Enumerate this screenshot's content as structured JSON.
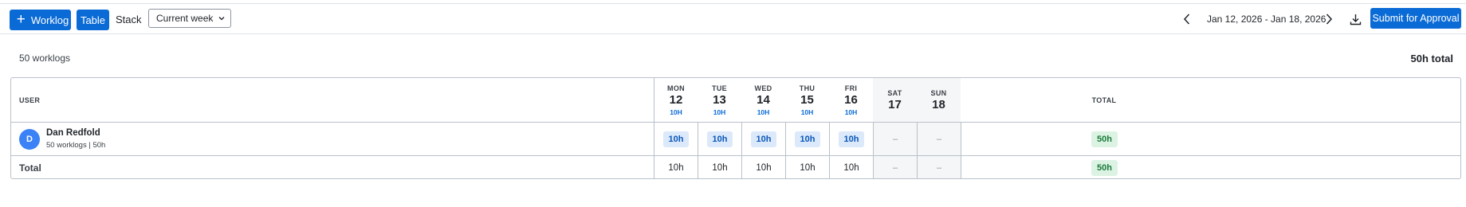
{
  "toolbar": {
    "worklog_label": "Worklog",
    "table_label": "Table",
    "stack_label": "Stack",
    "week_select_value": "Current week",
    "date_range": "Jan 12, 2026 - Jan 18, 2026",
    "submit_label": "Submit for Approval",
    "accent_color": "#0b6bd6"
  },
  "summary": {
    "count": "50 worklogs",
    "total": "50h total"
  },
  "table": {
    "user_header": "USER",
    "total_header": "TOTAL",
    "days": [
      {
        "dow": "MON",
        "num": "12",
        "hours": "10H"
      },
      {
        "dow": "TUE",
        "num": "13",
        "hours": "10H"
      },
      {
        "dow": "WED",
        "num": "14",
        "hours": "10H"
      },
      {
        "dow": "THU",
        "num": "15",
        "hours": "10H"
      },
      {
        "dow": "FRI",
        "num": "16",
        "hours": "10H"
      },
      {
        "dow": "SAT",
        "num": "17",
        "hours": ""
      },
      {
        "dow": "SUN",
        "num": "18",
        "hours": ""
      }
    ],
    "user_row": {
      "avatar": "D",
      "name": "Dan Redfold",
      "sub": "50 worklogs | 50h",
      "cells": [
        "10h",
        "10h",
        "10h",
        "10h",
        "10h",
        "–",
        "–"
      ],
      "total": "50h"
    },
    "total_row": {
      "label": "Total",
      "cells": [
        "10h",
        "10h",
        "10h",
        "10h",
        "10h",
        "–",
        "–"
      ],
      "total": "50h"
    }
  },
  "icons": {
    "add": "plus-icon",
    "week_select": "chevron-down-icon",
    "prev": "chevron-left-icon",
    "next": "chevron-right-icon",
    "download": "download-icon"
  }
}
